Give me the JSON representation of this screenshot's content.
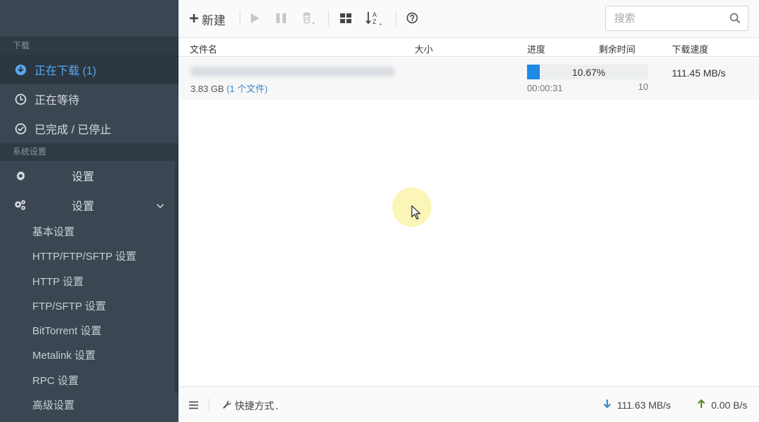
{
  "sidebar": {
    "download_section": "下载",
    "items": [
      {
        "label": "正在下载 (1)"
      },
      {
        "label": "正在等待"
      },
      {
        "label": "已完成 / 已停止"
      }
    ],
    "settings_section": "系统设置",
    "settings_items": [
      {
        "label": "设置"
      },
      {
        "label": "设置"
      }
    ],
    "sub_items": [
      {
        "label": "基本设置"
      },
      {
        "label": "HTTP/FTP/SFTP 设置"
      },
      {
        "label": "HTTP 设置"
      },
      {
        "label": "FTP/SFTP 设置"
      },
      {
        "label": "BitTorrent 设置"
      },
      {
        "label": "Metalink 设置"
      },
      {
        "label": "RPC 设置"
      },
      {
        "label": "高级设置"
      }
    ]
  },
  "toolbar": {
    "new_label": "新建",
    "search_placeholder": "搜索"
  },
  "table": {
    "headers": {
      "name": "文件名",
      "size": "大小",
      "progress": "进度",
      "remaining": "剩余时间",
      "speed": "下载速度"
    },
    "rows": [
      {
        "size": "3.83 GB",
        "files": "(1 个文件)",
        "progress_text": "10.67%",
        "progress_fraction": 0.1067,
        "elapsed": "00:00:31",
        "connections": "10",
        "speed": "111.45 MB/s"
      }
    ]
  },
  "footer": {
    "shortcut_label": "快捷方式",
    "download_speed": "111.63 MB/s",
    "upload_speed": "0.00 B/s"
  },
  "colors": {
    "accent": "#1e88e5",
    "sidebar_bg": "#3a4651",
    "upload_arrow": "#5a8a2a"
  }
}
